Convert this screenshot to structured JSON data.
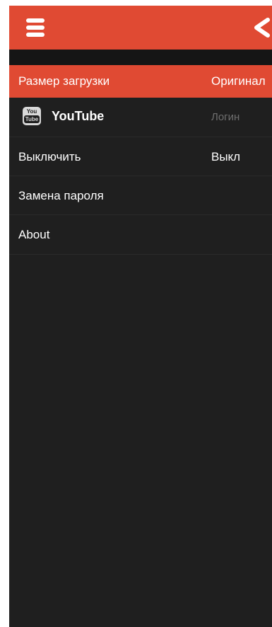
{
  "app": {
    "accent_color": "#e04a33",
    "background_color": "#1f1f1f"
  },
  "header": {
    "menu_icon": "hamburger-menu-icon",
    "back_icon": "chevron-left-icon"
  },
  "settings": {
    "download_size": {
      "label": "Размер загрузки",
      "value": "Оригинал"
    },
    "youtube": {
      "logo_top": "You",
      "logo_bottom": "Tube",
      "label": "YouTube",
      "value": "Логин"
    },
    "turn_off": {
      "label": "Выключить",
      "value": "Выкл"
    },
    "change_password": {
      "label": "Замена пароля"
    },
    "about": {
      "label": "About"
    }
  }
}
